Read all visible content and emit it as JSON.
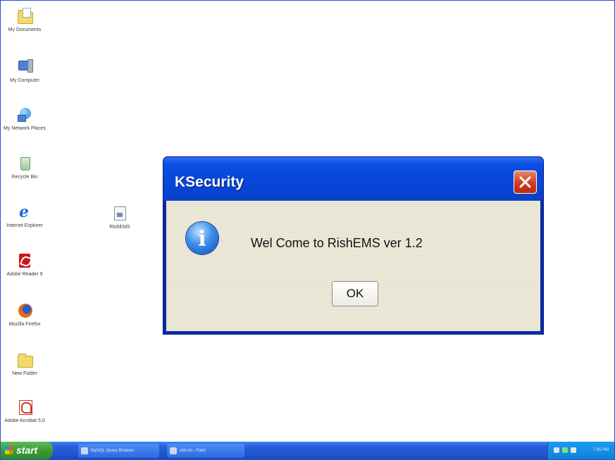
{
  "desktop": {
    "icons": [
      {
        "label": "My Documents"
      },
      {
        "label": "My Computer"
      },
      {
        "label": "My Network Places"
      },
      {
        "label": "Recycle Bin"
      },
      {
        "label": "Internet Explorer"
      },
      {
        "label": "Adobe Reader 9"
      },
      {
        "label": "Mozilla Firefox"
      },
      {
        "label": "New Folder"
      },
      {
        "label": "Adobe Acrobat 5.0"
      },
      {
        "label": "RishEMS"
      }
    ]
  },
  "dialog": {
    "title": "KSecurity",
    "message": "Wel Come to RishEMS ver 1.2",
    "ok_label": "OK",
    "icon": "info-icon"
  },
  "taskbar": {
    "start_label": "start",
    "tasks": [
      {
        "label": "MySQL Query Browser"
      },
      {
        "label": "ekk-en - Paint"
      }
    ],
    "clock": "7:05 PM"
  },
  "colors": {
    "titlebar": "#0746d8",
    "close_button": "#cf3b1f",
    "dialog_body": "#ece9d8",
    "taskbar": "#245edb",
    "start_button": "#3a9a36"
  }
}
